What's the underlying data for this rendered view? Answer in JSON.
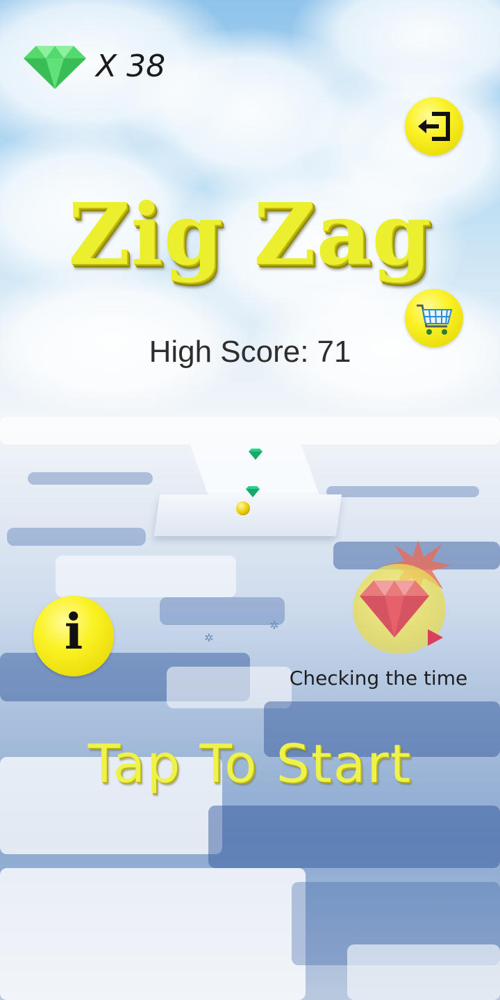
{
  "hud": {
    "gem_count": "X 38",
    "gem_icon": "green-diamond-icon"
  },
  "buttons": {
    "exit_icon": "exit-door-icon",
    "shop_icon": "shopping-cart-icon",
    "info_label": "i"
  },
  "title": "Zig Zag",
  "high_score": {
    "label": "High Score:",
    "value": "71"
  },
  "reward": {
    "icon": "ruby-gem-video-icon",
    "status_text": "Checking the time"
  },
  "start_prompt": "Tap To Start",
  "colors": {
    "accent_yellow": "#F5F02A",
    "title_yellow": "#ECEF2E",
    "gem_green": "#4CD36A",
    "text_dark": "#2E2E2E"
  }
}
